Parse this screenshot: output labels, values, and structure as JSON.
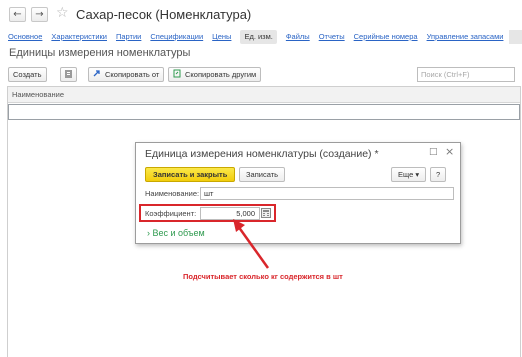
{
  "window": {
    "back_icon": "←",
    "forward_icon": "→",
    "favorite_icon": "☆",
    "title": "Сахар-песок (Номенклатура)"
  },
  "tabs": [
    {
      "label": "Основное",
      "active": false
    },
    {
      "label": "Характеристики",
      "active": false
    },
    {
      "label": "Партии",
      "active": false
    },
    {
      "label": "Спецификации",
      "active": false
    },
    {
      "label": "Цены",
      "active": false
    },
    {
      "label": "Ед. изм.",
      "active": true
    },
    {
      "label": "Файлы",
      "active": false
    },
    {
      "label": "Отчеты",
      "active": false
    },
    {
      "label": "Серийные номера",
      "active": false
    },
    {
      "label": "Управление запасами",
      "active": false
    }
  ],
  "section_title": "Единицы измерения номенклатуры",
  "toolbar": {
    "create_label": "Создать",
    "copy_from_label": "Скопировать от",
    "copy_to_label": "Скопировать другим",
    "search_placeholder": "Поиск (Ctrl+F)"
  },
  "grid": {
    "columns": [
      "Наименование"
    ]
  },
  "dialog": {
    "title": "Единица измерения номенклатуры (создание) *",
    "maximize_icon": "□",
    "close_icon": "×",
    "save_close_label": "Записать и закрыть",
    "save_label": "Записать",
    "more_label": "Еще",
    "more_icon": "▾",
    "help_label": "?",
    "name_label": "Наименование:",
    "name_value": "шт",
    "coef_label": "Коэффициент:",
    "coef_value": "5,000",
    "group_label": "Вес и объем",
    "group_icon": "›"
  },
  "annotation": {
    "text": "Подсчитывает сколько кг содержится в шт",
    "color": "#d9262b"
  },
  "colors": {
    "link": "#2a64c5",
    "primary_button": "#f2cd0c",
    "group_title": "#2f9a4f"
  }
}
